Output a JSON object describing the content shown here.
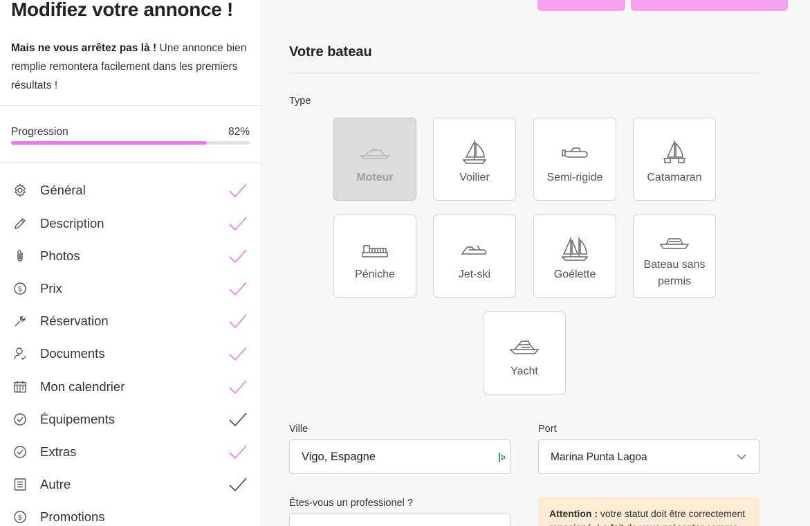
{
  "sidebar": {
    "title": "Modifiez votre annonce !",
    "intro_bold": "Mais ne vous arrêtez pas là !",
    "intro_rest": " Une annonce bien remplie remontera facilement dans les premiers résultats !",
    "progress": {
      "label": "Progression",
      "value_text": "82%",
      "value": 0.82
    },
    "items": [
      {
        "label": "Général",
        "icon": "gear-icon",
        "status": "complete"
      },
      {
        "label": "Description",
        "icon": "pencil-icon",
        "status": "complete"
      },
      {
        "label": "Photos",
        "icon": "paperclip-icon",
        "status": "complete"
      },
      {
        "label": "Prix",
        "icon": "dollar-circle-icon",
        "status": "complete"
      },
      {
        "label": "Réservation",
        "icon": "wrench-icon",
        "status": "complete"
      },
      {
        "label": "Documents",
        "icon": "user-check-icon",
        "status": "complete"
      },
      {
        "label": "Mon calendrier",
        "icon": "calendar-icon",
        "status": "complete"
      },
      {
        "label": "Équipements",
        "icon": "check-circle-icon",
        "status": "default"
      },
      {
        "label": "Extras",
        "icon": "check-circle-icon",
        "status": "complete"
      },
      {
        "label": "Autre",
        "icon": "list-icon",
        "status": "default"
      },
      {
        "label": "Promotions",
        "icon": "dollar-circle-icon",
        "status": "none"
      }
    ]
  },
  "main": {
    "section_title": "Votre bateau",
    "type_label": "Type",
    "boat_types": [
      {
        "label": "Moteur",
        "icon": "motorboat-icon",
        "selected": true
      },
      {
        "label": "Voilier",
        "icon": "sailboat-icon",
        "selected": false
      },
      {
        "label": "Semi-rigide",
        "icon": "rib-icon",
        "selected": false
      },
      {
        "label": "Catamaran",
        "icon": "catamaran-icon",
        "selected": false
      },
      {
        "label": "Péniche",
        "icon": "barge-icon",
        "selected": false
      },
      {
        "label": "Jet-ski",
        "icon": "jetski-icon",
        "selected": false
      },
      {
        "label": "Goélette",
        "icon": "schooner-icon",
        "selected": false
      },
      {
        "label": "Bateau sans permis",
        "icon": "small-boat-icon",
        "selected": false
      },
      {
        "label": "Yacht",
        "icon": "yacht-icon",
        "selected": false
      }
    ],
    "city": {
      "label": "Ville",
      "value": "Vigo, Espagne"
    },
    "port": {
      "label": "Port",
      "value": "Marina Punta Lagoa"
    },
    "pro_question": {
      "label": "Êtes-vous un professionel ?"
    },
    "alert": {
      "bold": "Attention :",
      "text": " votre statut doit être correctement renseigné. Le fait de vous présenter comme"
    }
  },
  "colors": {
    "accent": "#ef76e6",
    "check_complete": "#ef76e6",
    "check_default": "#444444",
    "alert_bg": "#fdebd6"
  }
}
